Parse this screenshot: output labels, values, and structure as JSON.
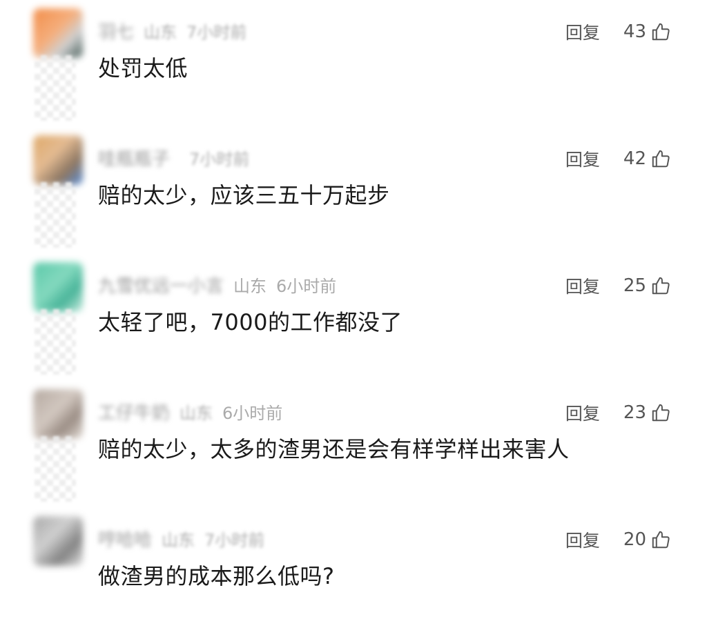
{
  "comments": [
    {
      "username": "羽七",
      "region": "山东",
      "time": "7小时前",
      "reply_label": "回复",
      "likes": "43",
      "text": "处罚太低"
    },
    {
      "username": "哇瓶瓶子",
      "region": "",
      "time": "7小时前",
      "reply_label": "回复",
      "likes": "42",
      "text": "赔的太少，应该三五十万起步"
    },
    {
      "username": "九雪优远一小言",
      "region": "山东",
      "time": "6小时前",
      "reply_label": "回复",
      "likes": "25",
      "text": "太轻了吧，7000的工作都没了"
    },
    {
      "username": "工仔牛奶",
      "region": "山东",
      "time": "6小时前",
      "reply_label": "回复",
      "likes": "23",
      "text": "赔的太少，太多的渣男还是会有样学样出来害人"
    },
    {
      "username": "哼哈哈",
      "region": "山东",
      "time": "7小时前",
      "reply_label": "回复",
      "likes": "20",
      "text": "做渣男的成本那么低吗?"
    }
  ],
  "colors": {
    "text_primary": "#1a1a1a",
    "text_secondary": "#999999",
    "action": "#555555"
  },
  "icons": {
    "like": "thumbs-up-icon"
  }
}
